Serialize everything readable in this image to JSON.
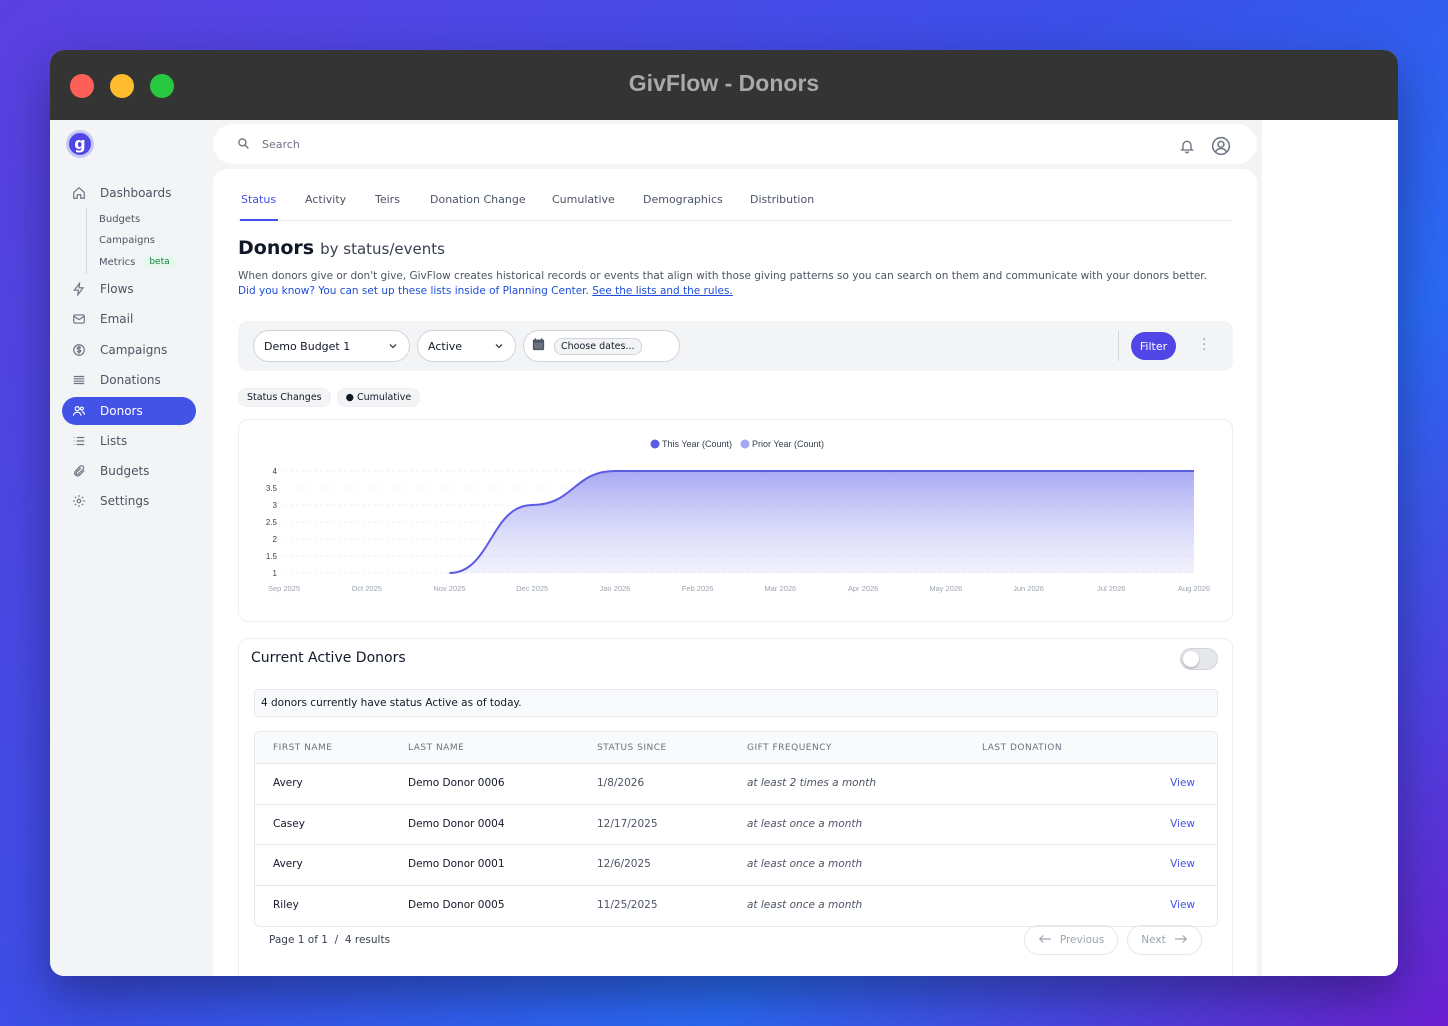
{
  "window": {
    "title": "GivFlow - Donors"
  },
  "sidebar": {
    "logo_letter": "g",
    "items": [
      {
        "label": "Dashboards",
        "icon": "home-icon"
      },
      {
        "label": "Flows",
        "icon": "bolt-icon"
      },
      {
        "label": "Email",
        "icon": "mail-icon"
      },
      {
        "label": "Campaigns",
        "icon": "dollar-icon"
      },
      {
        "label": "Donations",
        "icon": "list-lines-icon"
      },
      {
        "label": "Donors",
        "icon": "users-icon",
        "active": true
      },
      {
        "label": "Lists",
        "icon": "bullet-list-icon"
      },
      {
        "label": "Budgets",
        "icon": "paperclip-icon"
      },
      {
        "label": "Settings",
        "icon": "gear-icon"
      }
    ],
    "sub_items": [
      {
        "label": "Budgets"
      },
      {
        "label": "Campaigns"
      },
      {
        "label": "Metrics",
        "badge": "beta"
      }
    ]
  },
  "search": {
    "placeholder": "Search"
  },
  "tabs": [
    "Status",
    "Activity",
    "Teirs",
    "Donation Change",
    "Cumulative",
    "Demographics",
    "Distribution"
  ],
  "header": {
    "title": "Donors",
    "subtitle": "by status/events",
    "description": "When donors give or don't give, GivFlow creates historical records or events that align with those giving patterns so you can search on them and communicate with your donors better.",
    "tip": "Did you know? You can set up these lists inside of Planning Center.",
    "tip_link": "See the lists and the rules."
  },
  "filters": {
    "budget": "Demo Budget 1",
    "status": "Active",
    "date_placeholder": "Choose dates...",
    "filter_button": "Filter"
  },
  "chips": [
    "Status Changes",
    "Cumulative"
  ],
  "chart_data": {
    "type": "area",
    "x": [
      "Sep 2025",
      "Oct 2025",
      "Nov 2025",
      "Dec 2025",
      "Jan 2026",
      "Feb 2026",
      "Mar 2026",
      "Apr 2026",
      "May 2026",
      "Jun 2026",
      "Jul 2026",
      "Aug 2026"
    ],
    "series": [
      {
        "name": "This Year (Count)",
        "color": "#5b5ce2",
        "values": [
          null,
          null,
          1,
          3,
          4,
          4,
          4,
          4,
          4,
          4,
          4,
          4
        ]
      },
      {
        "name": "Prior Year (Count)",
        "color": "#a5a6f6",
        "values": []
      }
    ],
    "ylim": [
      1,
      4
    ],
    "yticks": [
      "1",
      "1.5",
      "2",
      "2.5",
      "3",
      "3.5",
      "4"
    ],
    "grid": true,
    "legend": "top-center"
  },
  "table": {
    "title": "Current Active Donors",
    "notice": "4 donors currently have status Active as of today.",
    "columns": [
      "FIRST NAME",
      "LAST NAME",
      "STATUS SINCE",
      "GIFT FREQUENCY",
      "LAST DONATION"
    ],
    "rows": [
      {
        "first": "Avery",
        "last": "Demo Donor 0006",
        "since": "1/8/2026",
        "freq": "at least 2 times a month",
        "last_donation": "",
        "action": "View"
      },
      {
        "first": "Casey",
        "last": "Demo Donor 0004",
        "since": "12/17/2025",
        "freq": "at least once a month",
        "last_donation": "",
        "action": "View"
      },
      {
        "first": "Avery",
        "last": "Demo Donor 0001",
        "since": "12/6/2025",
        "freq": "at least once a month",
        "last_donation": "",
        "action": "View"
      },
      {
        "first": "Riley",
        "last": "Demo Donor 0005",
        "since": "11/25/2025",
        "freq": "at least once a month",
        "last_donation": "",
        "action": "View"
      }
    ],
    "pagination": {
      "page_text": "Page 1 of 1",
      "separator": "/",
      "results_text": "4 results",
      "prev": "Previous",
      "next": "Next"
    }
  }
}
